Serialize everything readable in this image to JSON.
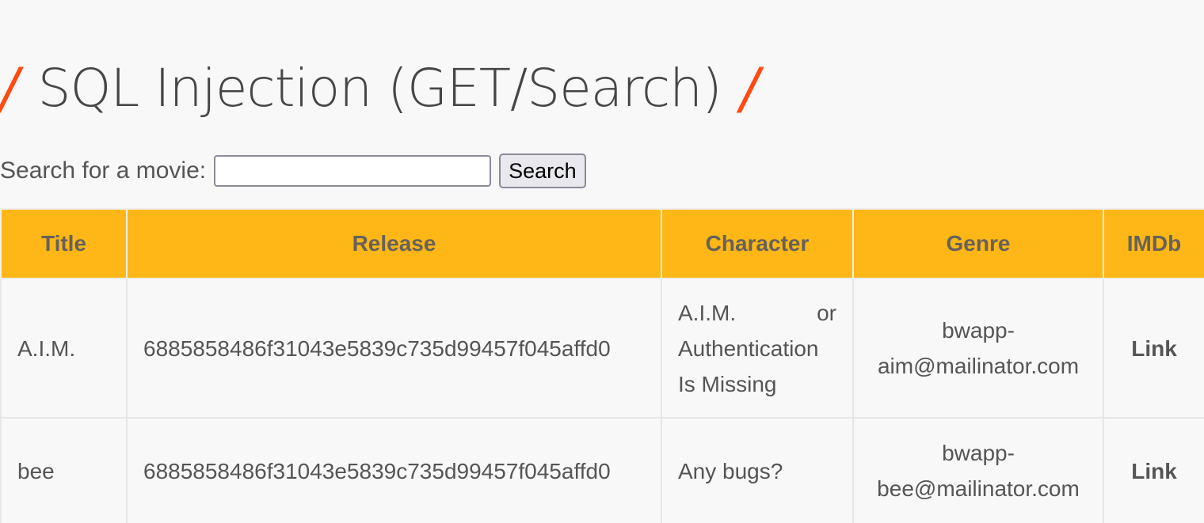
{
  "page": {
    "title": "SQL Injection (GET/Search)",
    "title_slash": "/"
  },
  "search": {
    "label": "Search for a movie:",
    "value": "",
    "placeholder": "",
    "button_label": "Search"
  },
  "table": {
    "headers": [
      "Title",
      "Release",
      "Character",
      "Genre",
      "IMDb"
    ],
    "rows": [
      {
        "title": "A.I.M.",
        "release": "6885858486f31043e5839c735d99457f045affd0",
        "character": "A.I.M. or Authentication Is Missing",
        "genre": "bwapp-aim@mailinator.com",
        "imdb": "Link"
      },
      {
        "title": "bee",
        "release": "6885858486f31043e5839c735d99457f045affd0",
        "character": "Any bugs?",
        "genre": "bwapp-bee@mailinator.com",
        "imdb": "Link"
      }
    ]
  },
  "colors": {
    "accent": "#ff4a12",
    "header_bg": "#ffb717",
    "page_bg": "#f8f8f8",
    "text": "#555555"
  }
}
